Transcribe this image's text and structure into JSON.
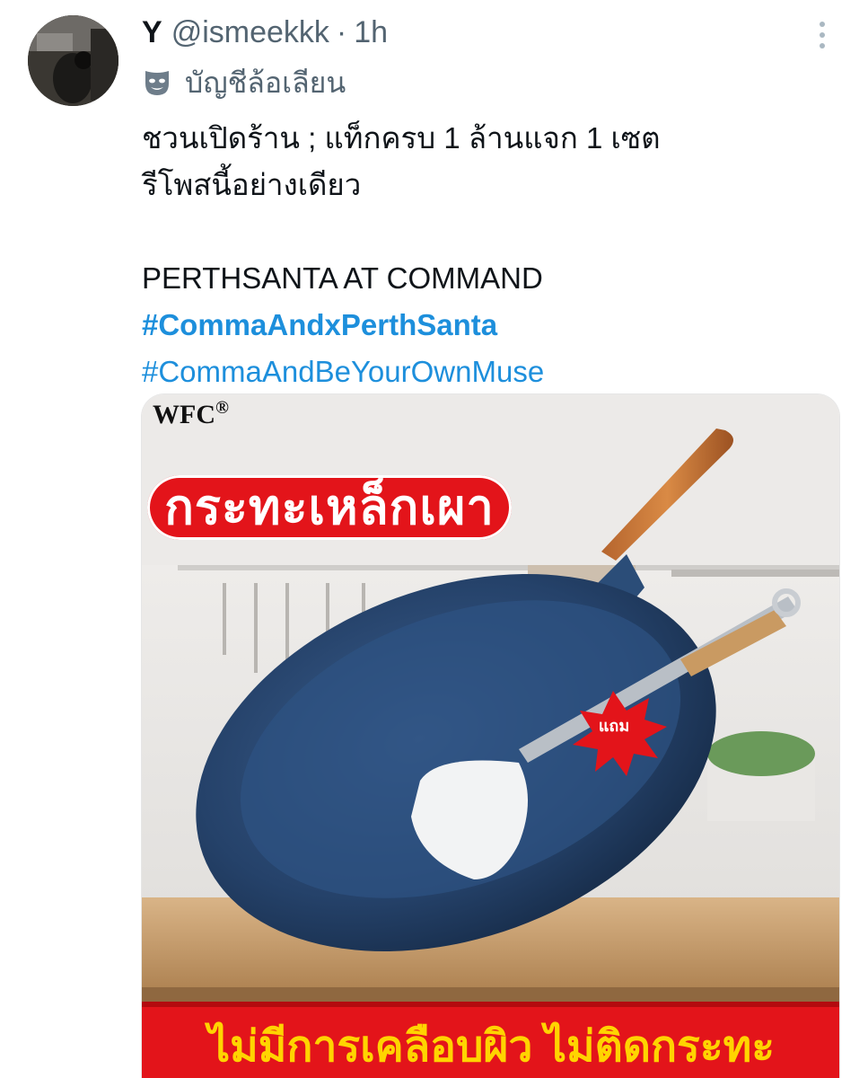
{
  "tweet": {
    "display_name": "Y",
    "handle": "@ismeekkk",
    "separator": "·",
    "time": "1h",
    "account_label": "บัญชีล้อเลียน",
    "text_lines": [
      "ชวนเปิดร้าน ; แท็กครบ 1 ล้านแจก 1 เซต",
      "รีโพสนี้อย่างเดียว",
      "",
      "PERTHSANTA AT COMMAND"
    ],
    "hashtags": [
      "#CommaAndxPerthSanta",
      "#CommaAndBeYourOwnMuse"
    ]
  },
  "media": {
    "brand": "WFC",
    "brand_mark": "®",
    "title": "กระทะเหล็กเผา",
    "gift_badge": "แถม",
    "banner": "ไม่มีการเคลือบผิว ไม่ติดกระทะ"
  },
  "icons": {
    "more": "more-vertical-icon",
    "parody": "theater-mask-icon"
  },
  "colors": {
    "link": "#1d8fdc",
    "secondary_text": "#536471",
    "banner_red": "#e3141a",
    "banner_yellow": "#ffd400"
  }
}
